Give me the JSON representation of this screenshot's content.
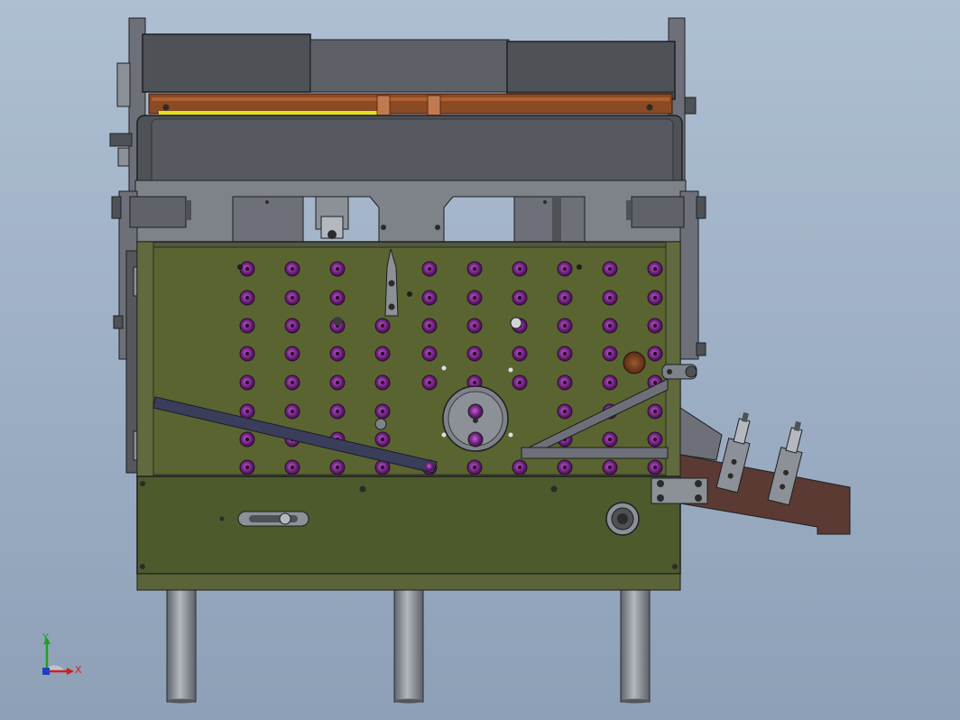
{
  "viewport": {
    "background_top": "#aebfd3",
    "background_bottom": "#8ea0b7"
  },
  "model": {
    "frame_color": "#515a3c",
    "panel_color": "#4d5a2c",
    "dark_grey": "#4e5156",
    "mid_grey": "#6d7078",
    "light_grey": "#8c9097",
    "copper": "#8a4a24",
    "yellow_strip": "#e4e01c",
    "stud_color": "#6b1e78",
    "chute_color": "#5a3a32",
    "leg_color": "#8a8f96"
  },
  "triad": {
    "x_label": "X",
    "y_label": "Y",
    "x_color": "#d02020",
    "y_color": "#20a020",
    "z_color": "#2040c0"
  }
}
